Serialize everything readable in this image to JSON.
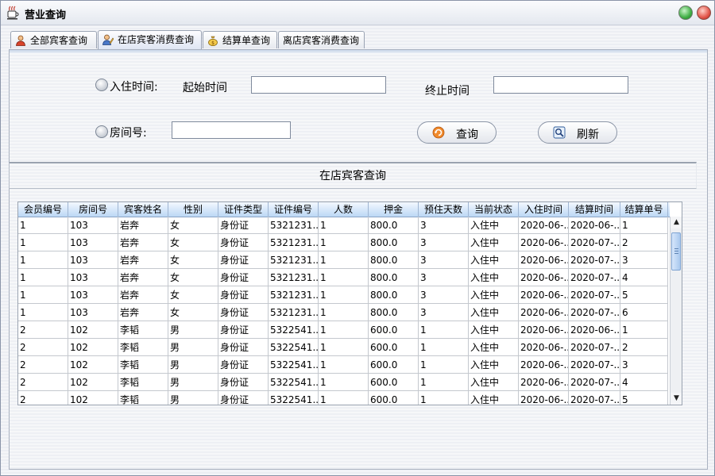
{
  "window": {
    "title": "营业查询"
  },
  "tabs": [
    {
      "label": "全部宾客查询"
    },
    {
      "label": "在店宾客消费查询"
    },
    {
      "label": "结算单查询"
    },
    {
      "label": "离店宾客消费查询"
    }
  ],
  "filters": {
    "checkin_label": "入住时间:",
    "start_label": "起始时间",
    "start_value": "",
    "end_label": "终止时间",
    "end_value": "",
    "room_label": "房间号:",
    "room_value": ""
  },
  "buttons": {
    "query": "查询",
    "refresh": "刷新"
  },
  "section": {
    "title": "在店宾客查询"
  },
  "table": {
    "columns": [
      "会员编号",
      "房间号",
      "宾客姓名",
      "性别",
      "证件类型",
      "证件编号",
      "人数",
      "押金",
      "预住天数",
      "当前状态",
      "入住时间",
      "结算时间",
      "结算单号"
    ],
    "rows": [
      [
        "1",
        "103",
        "岩奔",
        "女",
        "身份证",
        "5321231...",
        "1",
        "800.0",
        "3",
        "入住中",
        "2020-06-...",
        "2020-06-...",
        "1"
      ],
      [
        "1",
        "103",
        "岩奔",
        "女",
        "身份证",
        "5321231...",
        "1",
        "800.0",
        "3",
        "入住中",
        "2020-06-...",
        "2020-07-...",
        "2"
      ],
      [
        "1",
        "103",
        "岩奔",
        "女",
        "身份证",
        "5321231...",
        "1",
        "800.0",
        "3",
        "入住中",
        "2020-06-...",
        "2020-07-...",
        "3"
      ],
      [
        "1",
        "103",
        "岩奔",
        "女",
        "身份证",
        "5321231...",
        "1",
        "800.0",
        "3",
        "入住中",
        "2020-06-...",
        "2020-07-...",
        "4"
      ],
      [
        "1",
        "103",
        "岩奔",
        "女",
        "身份证",
        "5321231...",
        "1",
        "800.0",
        "3",
        "入住中",
        "2020-06-...",
        "2020-07-...",
        "5"
      ],
      [
        "1",
        "103",
        "岩奔",
        "女",
        "身份证",
        "5321231...",
        "1",
        "800.0",
        "3",
        "入住中",
        "2020-06-...",
        "2020-07-...",
        "6"
      ],
      [
        "2",
        "102",
        "李韬",
        "男",
        "身份证",
        "5322541...",
        "1",
        "600.0",
        "1",
        "入住中",
        "2020-06-...",
        "2020-06-...",
        "1"
      ],
      [
        "2",
        "102",
        "李韬",
        "男",
        "身份证",
        "5322541...",
        "1",
        "600.0",
        "1",
        "入住中",
        "2020-06-...",
        "2020-07-...",
        "2"
      ],
      [
        "2",
        "102",
        "李韬",
        "男",
        "身份证",
        "5322541...",
        "1",
        "600.0",
        "1",
        "入住中",
        "2020-06-...",
        "2020-07-...",
        "3"
      ],
      [
        "2",
        "102",
        "李韬",
        "男",
        "身份证",
        "5322541...",
        "1",
        "600.0",
        "1",
        "入住中",
        "2020-06-...",
        "2020-07-...",
        "4"
      ],
      [
        "2",
        "102",
        "李韬",
        "男",
        "身份证",
        "5322541...",
        "1",
        "600.0",
        "1",
        "入住中",
        "2020-06-...",
        "2020-07-...",
        "5"
      ]
    ]
  },
  "icons": {
    "app": "coffee-cup-icon",
    "tab_all": "person-icon",
    "tab_instore": "person-pencil-icon",
    "tab_bill": "money-bag-icon",
    "query": "refresh-circle-icon",
    "refresh": "magnifier-icon"
  }
}
